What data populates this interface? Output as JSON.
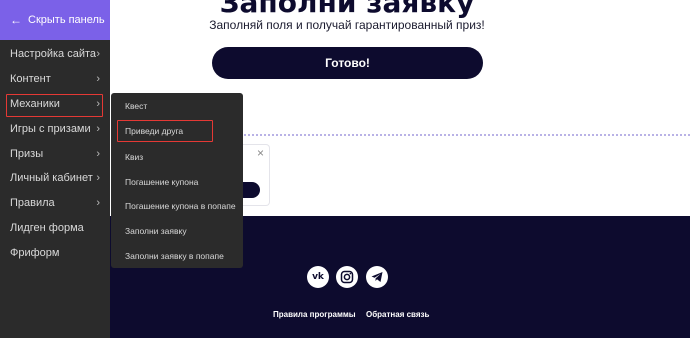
{
  "main": {
    "title": "Заполни заявку",
    "subtitle": "Заполняй поля и получай гарантированный приз!",
    "ready_button": "Готово!"
  },
  "popup": {
    "close_icon": "×"
  },
  "sidebar": {
    "hide_panel": "Скрыть панель",
    "items": [
      {
        "label": "Настройка сайта",
        "chevron": "›"
      },
      {
        "label": "Контент",
        "chevron": "›"
      },
      {
        "label": "Механики",
        "chevron": "›"
      },
      {
        "label": "Игры с призами",
        "chevron": "›"
      },
      {
        "label": "Призы",
        "chevron": "›"
      },
      {
        "label": "Личный кабинет",
        "chevron": "›"
      },
      {
        "label": "Правила",
        "chevron": "›"
      },
      {
        "label": "Лидген форма",
        "chevron": ""
      },
      {
        "label": "Фриформ",
        "chevron": ""
      }
    ]
  },
  "submenu": {
    "items": [
      {
        "label": "Квест"
      },
      {
        "label": "Приведи друга"
      },
      {
        "label": "Квиз"
      },
      {
        "label": "Погашение купона"
      },
      {
        "label": "Погашение купона в попапе"
      },
      {
        "label": "Заполни заявку"
      },
      {
        "label": "Заполни заявку в попапе"
      }
    ]
  },
  "footer": {
    "social_icons": [
      "vk-icon",
      "instagram-icon",
      "telegram-icon"
    ],
    "vk_label": "vk",
    "links": [
      "Правила программы",
      "Обратная связь"
    ]
  },
  "colors": {
    "accent": "#7b61e8",
    "sidebar_bg": "#2b2b2b",
    "footer_bg": "#0d0b2e",
    "highlight": "#e53935"
  }
}
